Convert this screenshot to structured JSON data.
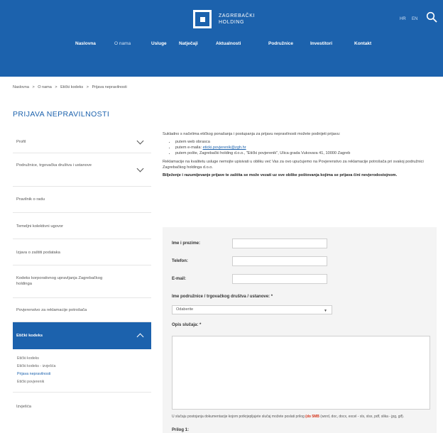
{
  "header": {
    "logo_line1": "ZAGREBAČKI",
    "logo_line2": "HOLDING",
    "lang_hr": "HR",
    "lang_en": "EN",
    "nav": [
      "Naslovna",
      "O nama",
      "Usluge",
      "Natječaji",
      "Aktualnosti",
      "Podružnice",
      "Investitori",
      "Kontakt"
    ],
    "colors": {
      "header_bg": "#1c62ad",
      "accent": "#1c62ad"
    }
  },
  "breadcrumb": [
    "Naslovna",
    ">",
    "O nama",
    ">",
    "Etički kodeks",
    ">",
    "Prijava nepravilnosti"
  ],
  "page_title": "PRIJAVA NEPRAVILNOSTI",
  "sidebar": {
    "items": [
      "Profil",
      "Podružnice, trgovačka društva i ustanove",
      "Pravilnik o radu",
      "Temeljni kolektivni ugovor",
      "Izjava o zaštiti podataka",
      "Kodeks korporativnog upravljanja Zagrebačkog holdinga",
      "Povjerenstvo za reklamacije potrošača"
    ],
    "active": "Etički kodeks",
    "subitems": [
      "Etički kodeks",
      "Etički kodeks - izvješća",
      "Prijava nepravilnosti",
      "Etički povjerenik"
    ],
    "last_item": "Izvješća"
  },
  "content": {
    "intro": "Sukladno s načelima etičkog ponašanja i postupanja za prijavu nepravilnosti možete podnijeti prijavu:",
    "bullets": [
      "putem web obrasca",
      "putem e-maila: ",
      "putem pošte, Zagrebački holding d.o.o., \"Etički povjerenik\", Ulica grada Vukovara 41, 10000 Zagreb"
    ],
    "email": "eticki.povjerenik@zgh.hr",
    "para2": "Reklamacije na kvalitetu usluge nemojte upisivati u obliku već Vas za ovo upućujemo na Povjerenstvo za reklamacije potrošača pri svakoj podružnici Zagrebačkog holdinga d.o.o.",
    "para3": "Bilježenje i razumijevanje prijave te zaštita se može vezati uz sve oblike poštovanja kojima se prijava čini nevjerodostojnom."
  },
  "form": {
    "name_label": "Ime i prezime:",
    "phone_label": "Telefon:",
    "email_label": "E-mail:",
    "branch_label": "Ime podružnice / trgovačkog društva / ustanove: *",
    "branch_value": "Odaberite",
    "description_label": "Opis slučaja: *",
    "attachment_note": "U slučaju postojanja dokumentacije kojom potkrjepljujete slučaj možete poslati prilog",
    "attachment_note_red": "(do 5MB",
    "attachment_note2": "(word, doc, docx, excel - xls, xlsx, pdf, slika - jpg, gif).",
    "attachment_label": "Prilog 1:"
  }
}
